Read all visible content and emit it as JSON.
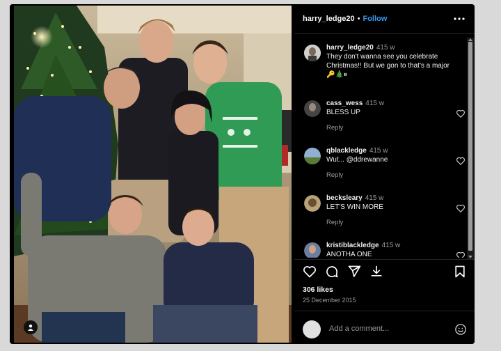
{
  "post": {
    "username": "harry_ledge20",
    "separator": "•",
    "follow_label": "Follow",
    "more_label": "•••"
  },
  "caption": {
    "username": "harry_ledge20",
    "time": "415 w",
    "text": "They don't wanna see you celebrate Christmas!! But we gon to that's a major",
    "emojis": "🔑🎄⏸"
  },
  "comments": [
    {
      "username": "cass_wess",
      "time": "415 w",
      "text": "BLESS UP",
      "reply_label": "Reply"
    },
    {
      "username": "qblackledge",
      "time": "415 w",
      "text": "Wut... @ddrewanne",
      "reply_label": "Reply"
    },
    {
      "username": "becksleary",
      "time": "415 w",
      "text": "LET'S WIN MORE",
      "reply_label": "Reply"
    },
    {
      "username": "kristiblackledge",
      "time": "415 w",
      "text": "ANOTHA ONE",
      "reply_label": ""
    }
  ],
  "actions": {
    "icons": [
      "heart-icon",
      "comment-icon",
      "share-icon",
      "save-icon"
    ]
  },
  "likes": "306 likes",
  "date": "25 December 2015",
  "add_comment": {
    "placeholder": "Add a comment..."
  },
  "colors": {
    "follow": "#3897f0",
    "background": "#000000",
    "muted": "#9b9b9b"
  }
}
